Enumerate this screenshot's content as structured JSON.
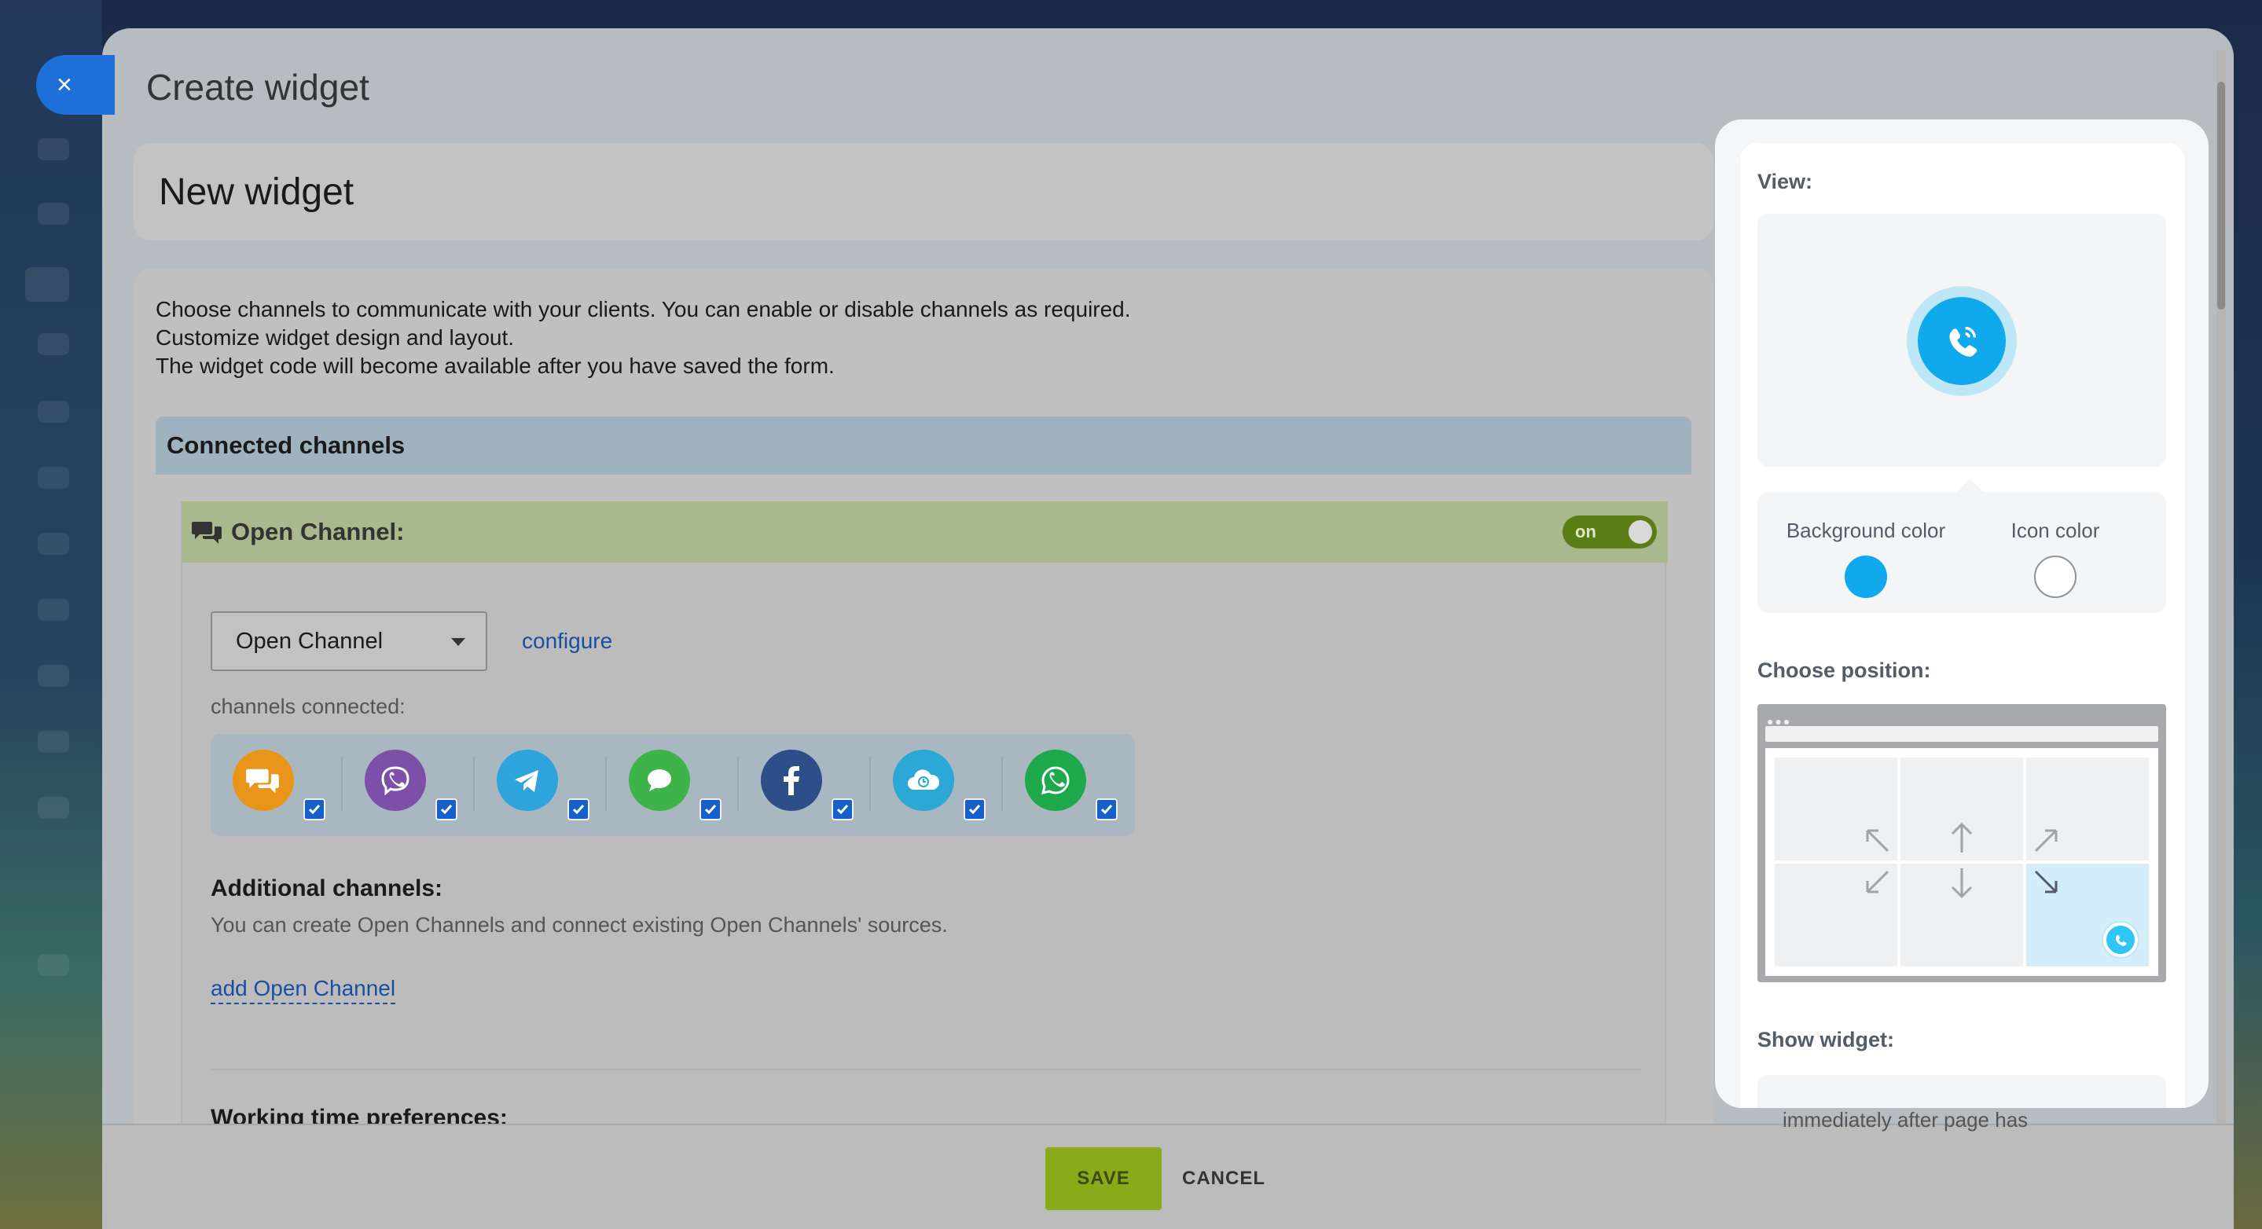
{
  "modal": {
    "title": "Create widget",
    "close_label": "×"
  },
  "form": {
    "widget_name": "New widget",
    "description": [
      "Choose channels to communicate with your clients. You can enable or disable channels as required.",
      "Customize widget design and layout.",
      "The widget code will become available after you have saved the form."
    ],
    "connected_channels_title": "Connected channels",
    "open_channel": {
      "title": "Open Channel:",
      "toggle_label": "on",
      "toggle_state": true,
      "selected": "Open Channel",
      "configure_label": "configure",
      "channels_connected_label": "channels connected:",
      "channels": [
        {
          "name": "live-chat",
          "icon": "chat-bubbles-icon",
          "color": "#e8951a",
          "checked": true
        },
        {
          "name": "viber",
          "icon": "viber-icon",
          "color": "#7c4fa8",
          "checked": true
        },
        {
          "name": "telegram",
          "icon": "telegram-icon",
          "color": "#2ea3dc",
          "checked": true
        },
        {
          "name": "imessage",
          "icon": "message-bubble-icon",
          "color": "#3eb34a",
          "checked": true
        },
        {
          "name": "facebook",
          "icon": "facebook-icon",
          "color": "#2e4e8a",
          "checked": true
        },
        {
          "name": "cloud",
          "icon": "cloud-clock-icon",
          "color": "#2ba8d6",
          "checked": true
        },
        {
          "name": "whatsapp",
          "icon": "whatsapp-icon",
          "color": "#1ea84c",
          "checked": true
        }
      ]
    },
    "additional": {
      "title": "Additional channels:",
      "description": "You can create Open Channels and connect existing Open Channels' sources.",
      "add_link": "add Open Channel"
    },
    "working_time_title": "Working time preferences:"
  },
  "footer": {
    "save_label": "SAVE",
    "cancel_label": "CANCEL"
  },
  "preview": {
    "view_label": "View:",
    "background_color_label": "Background color",
    "icon_color_label": "Icon color",
    "background_color": "#11a9ed",
    "icon_color": "#ffffff",
    "choose_position_label": "Choose position:",
    "selected_position": "bottom-right",
    "show_widget_label": "Show widget:",
    "show_option_partial": "immediately after page has"
  },
  "colors": {
    "accent_blue": "#1f6fd8",
    "save_green": "#8aab19",
    "widget_blue": "#11a9ed"
  }
}
